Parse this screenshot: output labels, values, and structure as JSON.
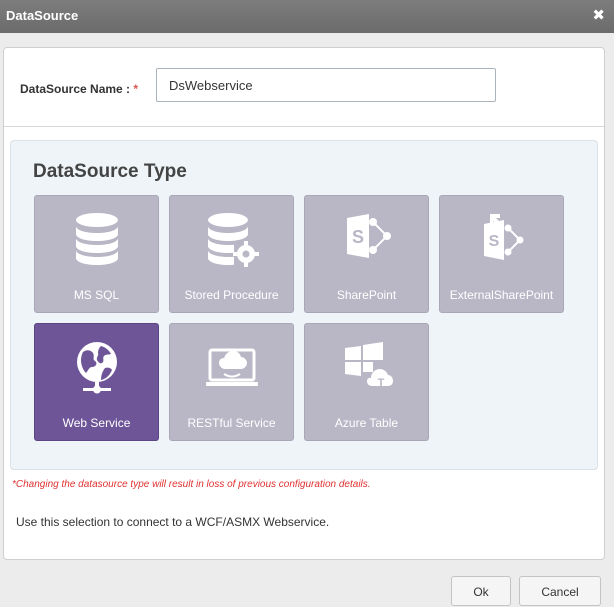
{
  "window": {
    "title": "DataSource",
    "close_glyph": "✖"
  },
  "form": {
    "name_label": "DataSource Name : ",
    "required_mark": "*",
    "name_value": "DsWebservice"
  },
  "type_section": {
    "title": "DataSource Type",
    "tiles": [
      {
        "label": "MS SQL",
        "icon": "database-icon",
        "selected": false
      },
      {
        "label": "Stored Procedure",
        "icon": "database-gear-icon",
        "selected": false
      },
      {
        "label": "SharePoint",
        "icon": "sharepoint-icon",
        "selected": false
      },
      {
        "label": "ExternalSharePoint",
        "icon": "external-sharepoint-icon",
        "selected": false
      },
      {
        "label": "Web Service",
        "icon": "globe-icon",
        "selected": true
      },
      {
        "label": "RESTful Service",
        "icon": "cloud-laptop-icon",
        "selected": false
      },
      {
        "label": "Azure Table",
        "icon": "azure-windows-cloud-icon",
        "selected": false
      }
    ]
  },
  "warning": "*Changing the datasource type will result in loss of previous configuration details.",
  "description": "Use this selection to connect to a WCF/ASMX Webservice.",
  "buttons": {
    "ok": "Ok",
    "cancel": "Cancel"
  },
  "colors": {
    "tile_default": "#b9b7c6",
    "tile_selected": "#6e5598",
    "required": "#d9534f",
    "warning": "#e03131",
    "title_bar": "#737373"
  }
}
